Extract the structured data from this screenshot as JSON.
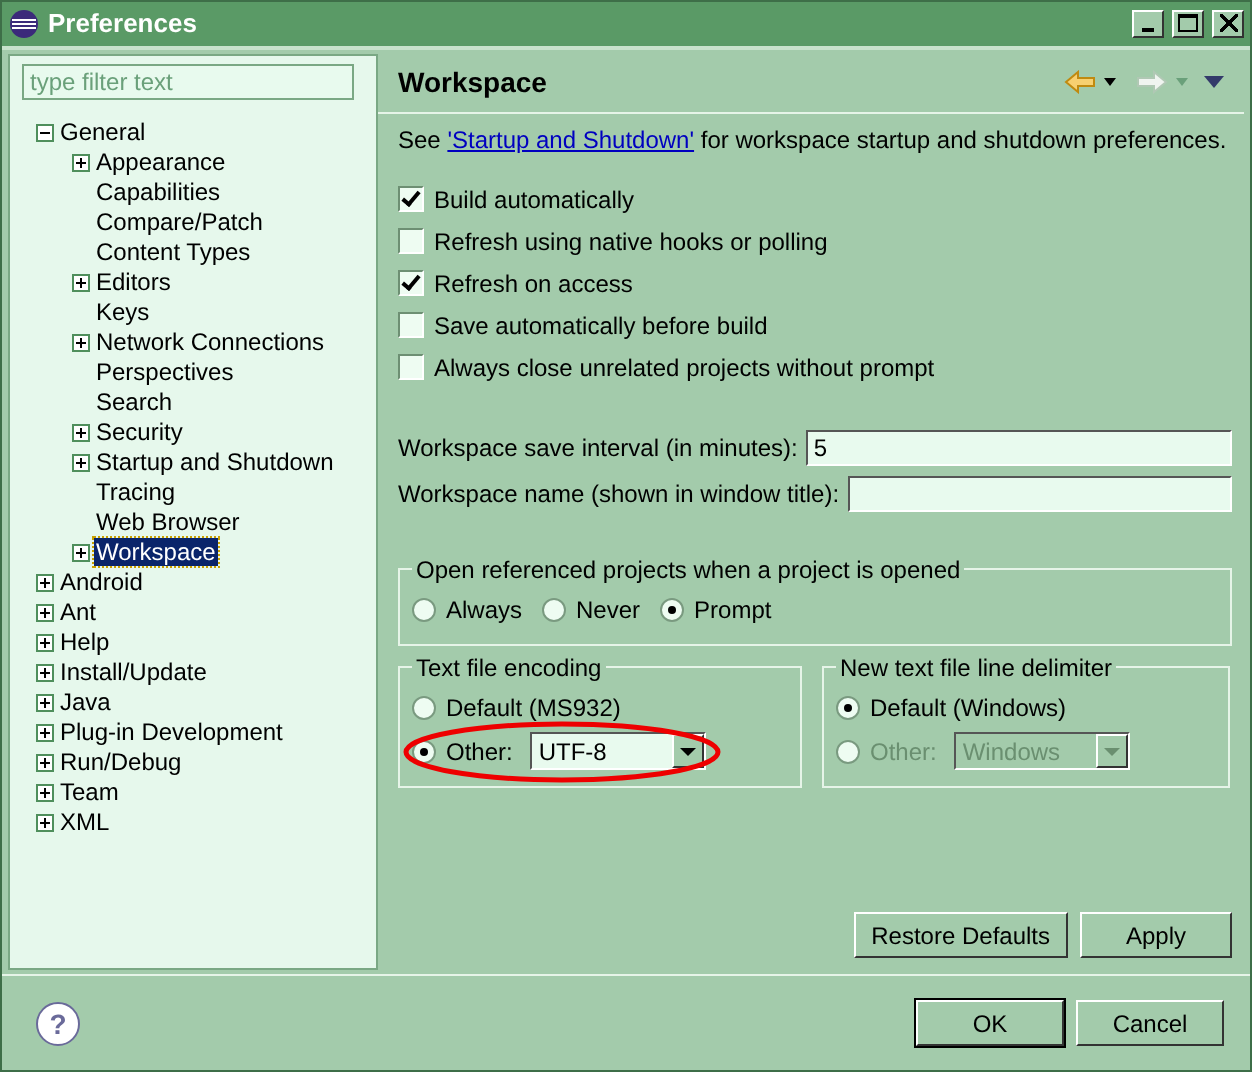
{
  "window": {
    "title": "Preferences"
  },
  "filter": {
    "placeholder": "type filter text"
  },
  "tree": [
    {
      "label": "General",
      "kind": "branch",
      "expanded": true,
      "selected": false,
      "children": [
        {
          "label": "Appearance",
          "kind": "branch",
          "expanded": false,
          "selected": false
        },
        {
          "label": "Capabilities",
          "kind": "leaf",
          "selected": false
        },
        {
          "label": "Compare/Patch",
          "kind": "leaf",
          "selected": false
        },
        {
          "label": "Content Types",
          "kind": "leaf",
          "selected": false
        },
        {
          "label": "Editors",
          "kind": "branch",
          "expanded": false,
          "selected": false
        },
        {
          "label": "Keys",
          "kind": "leaf",
          "selected": false
        },
        {
          "label": "Network Connections",
          "kind": "branch",
          "expanded": false,
          "selected": false
        },
        {
          "label": "Perspectives",
          "kind": "leaf",
          "selected": false
        },
        {
          "label": "Search",
          "kind": "leaf",
          "selected": false
        },
        {
          "label": "Security",
          "kind": "branch",
          "expanded": false,
          "selected": false
        },
        {
          "label": "Startup and Shutdown",
          "kind": "branch",
          "expanded": false,
          "selected": false
        },
        {
          "label": "Tracing",
          "kind": "leaf",
          "selected": false
        },
        {
          "label": "Web Browser",
          "kind": "leaf",
          "selected": false
        },
        {
          "label": "Workspace",
          "kind": "branch",
          "expanded": false,
          "selected": true
        }
      ]
    },
    {
      "label": "Android",
      "kind": "branch",
      "expanded": false,
      "selected": false
    },
    {
      "label": "Ant",
      "kind": "branch",
      "expanded": false,
      "selected": false
    },
    {
      "label": "Help",
      "kind": "branch",
      "expanded": false,
      "selected": false
    },
    {
      "label": "Install/Update",
      "kind": "branch",
      "expanded": false,
      "selected": false
    },
    {
      "label": "Java",
      "kind": "branch",
      "expanded": false,
      "selected": false
    },
    {
      "label": "Plug-in Development",
      "kind": "branch",
      "expanded": false,
      "selected": false
    },
    {
      "label": "Run/Debug",
      "kind": "branch",
      "expanded": false,
      "selected": false
    },
    {
      "label": "Team",
      "kind": "branch",
      "expanded": false,
      "selected": false
    },
    {
      "label": "XML",
      "kind": "branch",
      "expanded": false,
      "selected": false
    }
  ],
  "page": {
    "title": "Workspace",
    "intro": {
      "before": "See ",
      "link": "'Startup and Shutdown'",
      "after": " for workspace startup and shutdown preferences."
    },
    "checkboxes": [
      {
        "label": "Build automatically",
        "checked": true
      },
      {
        "label": "Refresh using native hooks or polling",
        "checked": false
      },
      {
        "label": "Refresh on access",
        "checked": true
      },
      {
        "label": "Save automatically before build",
        "checked": false
      },
      {
        "label": "Always close unrelated projects without prompt",
        "checked": false
      }
    ],
    "fields": [
      {
        "label": "Workspace save interval (in minutes):",
        "value": "5"
      },
      {
        "label": "Workspace name (shown in window title):"
      }
    ],
    "open_projects": {
      "title": "Open referenced projects when a project is opened",
      "options": [
        {
          "label": "Always",
          "selected": false
        },
        {
          "label": "Never",
          "selected": false
        },
        {
          "label": "Prompt",
          "selected": true
        }
      ]
    },
    "encoding": {
      "title": "Text file encoding",
      "options": [
        {
          "label": "Default (MS932)",
          "selected": false,
          "kind": "plain"
        },
        {
          "label": "Other:",
          "selected": true,
          "kind": "combo",
          "value": "UTF-8",
          "disabled": false,
          "highlighted": true
        }
      ]
    },
    "delimiter": {
      "title": "New text file line delimiter",
      "options": [
        {
          "label": "Default (Windows)",
          "selected": true,
          "kind": "plain"
        },
        {
          "label": "Other:",
          "selected": false,
          "kind": "combo",
          "value": "Windows",
          "disabled": true,
          "highlighted": false
        }
      ]
    },
    "buttons": [
      "Restore Defaults",
      "Apply"
    ]
  },
  "help": {
    "label": "?"
  },
  "dialog_buttons": [
    {
      "label": "OK",
      "default": true
    },
    {
      "label": "Cancel",
      "default": false
    }
  ]
}
